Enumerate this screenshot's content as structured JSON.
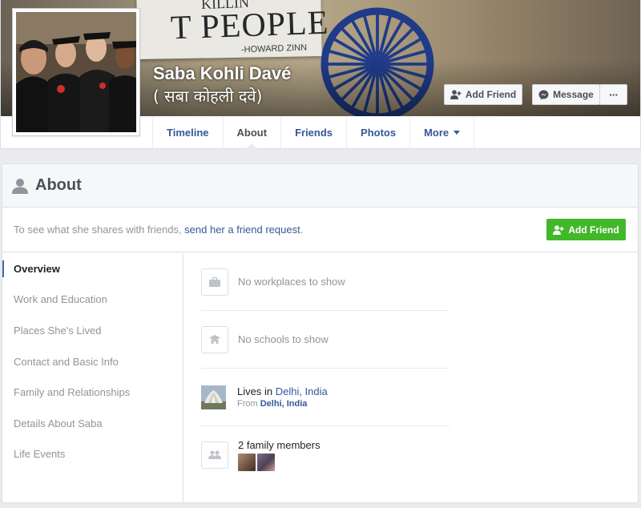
{
  "profile": {
    "name": "Saba Kohli Davé",
    "alt_name": "( सबा कोहली दवे)"
  },
  "cover": {
    "sign_main": "T PEOPLE",
    "sign_top": "KILLIN",
    "sign_credit": "-HOWARD ZINN"
  },
  "header_buttons": {
    "add_friend": "Add Friend",
    "message": "Message",
    "more": "···"
  },
  "tabs": [
    {
      "label": "Timeline"
    },
    {
      "label": "About"
    },
    {
      "label": "Friends"
    },
    {
      "label": "Photos"
    },
    {
      "label": "More"
    }
  ],
  "about": {
    "title": "About",
    "request_prefix": "To see what she shares with friends, ",
    "request_link": "send her a friend request",
    "request_suffix": ".",
    "add_friend": "Add Friend"
  },
  "sidebar": {
    "items": [
      {
        "label": "Overview"
      },
      {
        "label": "Work and Education"
      },
      {
        "label": "Places She's Lived"
      },
      {
        "label": "Contact and Basic Info"
      },
      {
        "label": "Family and Relationships"
      },
      {
        "label": "Details About Saba"
      },
      {
        "label": "Life Events"
      }
    ]
  },
  "overview": {
    "workplaces": "No workplaces to show",
    "schools": "No schools to show",
    "lives_prefix": "Lives in ",
    "lives_city": "Delhi, India",
    "from_prefix": "From ",
    "from_city": "Delhi, India",
    "family": "2 family members"
  },
  "colors": {
    "link": "#365899",
    "accent": "#4267b2",
    "green": "#42b72a"
  }
}
